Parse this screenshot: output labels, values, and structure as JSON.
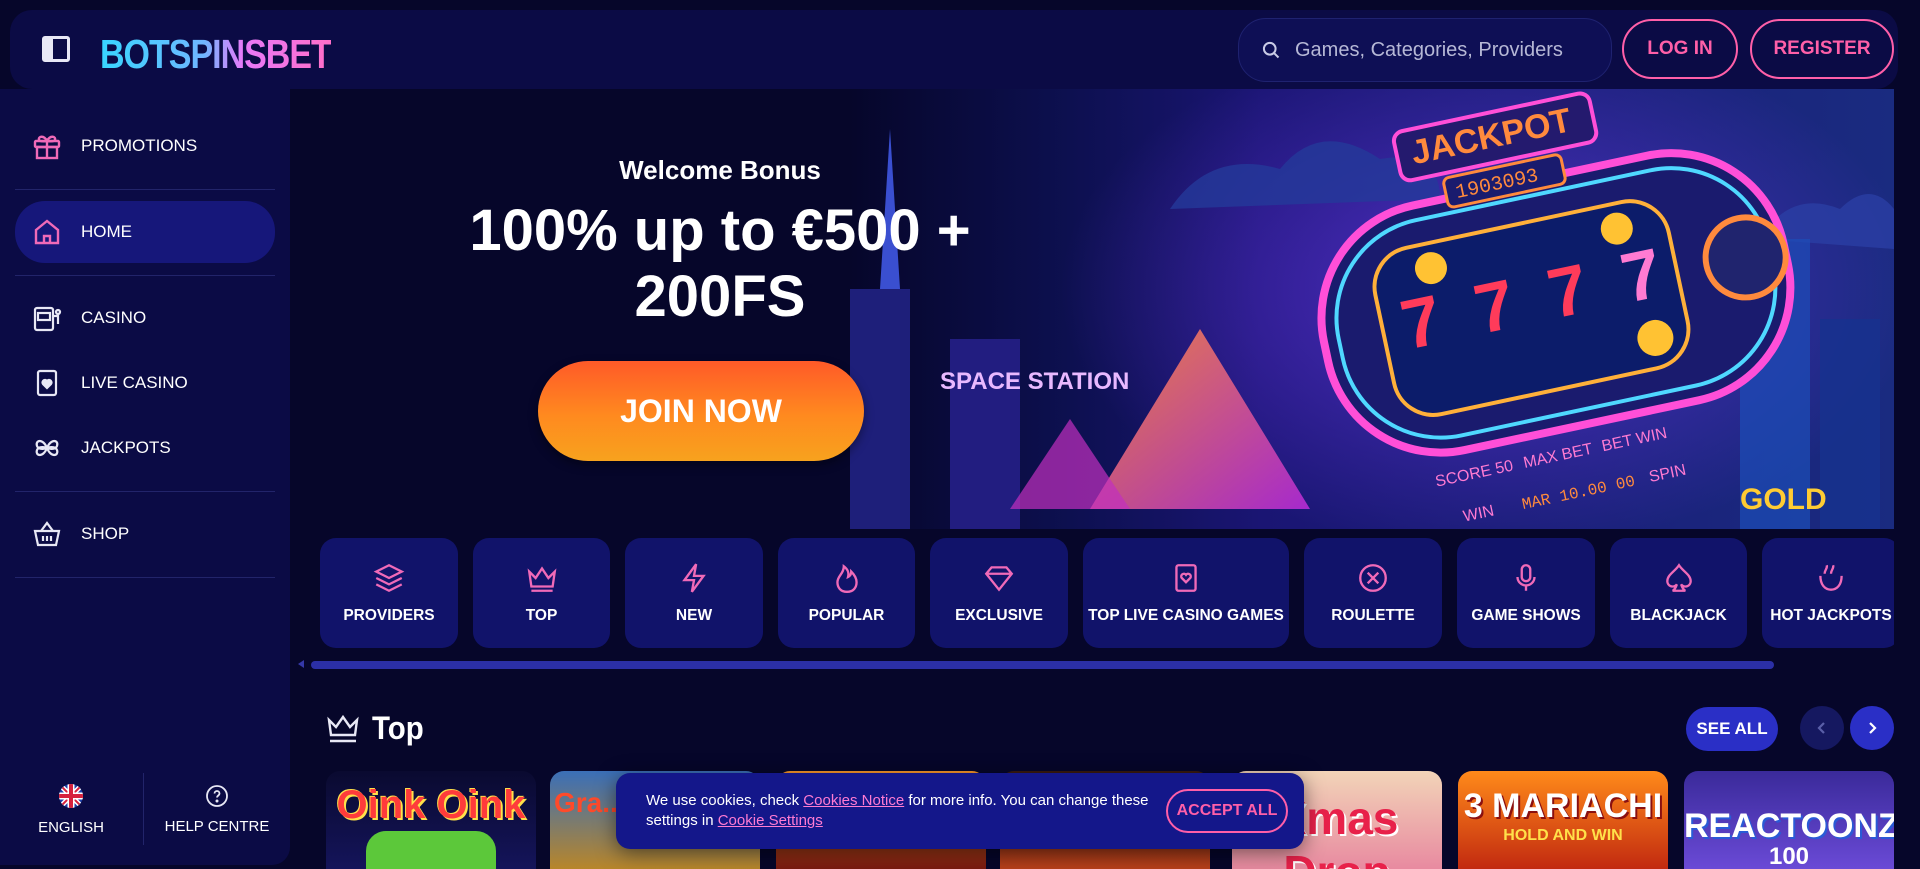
{
  "header": {
    "logo": "BOTSPINSBET",
    "search_placeholder": "Games, Categories, Providers",
    "login_label": "LOG IN",
    "register_label": "REGISTER"
  },
  "sidebar": {
    "items": [
      {
        "label": "PROMOTIONS",
        "icon": "gift-icon"
      },
      {
        "label": "HOME",
        "icon": "home-icon",
        "active": true
      },
      {
        "label": "CASINO",
        "icon": "slot-machine-icon"
      },
      {
        "label": "LIVE CASINO",
        "icon": "card-icon"
      },
      {
        "label": "JACKPOTS",
        "icon": "clover-icon"
      },
      {
        "label": "SHOP",
        "icon": "basket-icon"
      }
    ],
    "language_label": "ENGLISH",
    "help_label": "HELP CENTRE"
  },
  "hero": {
    "subtitle": "Welcome Bonus",
    "title_line1": "100% up to €500 +",
    "title_line2": "200FS",
    "cta_label": "JOIN NOW",
    "art_text": {
      "jackpot": "JACKPOT",
      "jackpot_number": "1903093",
      "station": "SPACE STATION",
      "score": "SCORE 50",
      "max_bet": "MAX BET",
      "bet_win": "BET WIN",
      "win": "WIN",
      "time": "MAR 10.00 00",
      "spin": "SPIN",
      "gold": "GOLD"
    }
  },
  "categories": [
    {
      "label": "PROVIDERS",
      "icon": "layers-icon"
    },
    {
      "label": "TOP",
      "icon": "crown-icon"
    },
    {
      "label": "NEW",
      "icon": "lightning-icon"
    },
    {
      "label": "POPULAR",
      "icon": "flame-icon"
    },
    {
      "label": "EXCLUSIVE",
      "icon": "diamond-icon"
    },
    {
      "label": "TOP LIVE CASINO GAMES",
      "icon": "card-heart-icon"
    },
    {
      "label": "ROULETTE",
      "icon": "roulette-icon"
    },
    {
      "label": "GAME SHOWS",
      "icon": "microphone-icon"
    },
    {
      "label": "BLACKJACK",
      "icon": "spade-icon"
    },
    {
      "label": "HOT JACKPOTS",
      "icon": "hot-pot-icon"
    }
  ],
  "top_section": {
    "title": "Top",
    "see_all_label": "SEE ALL",
    "games": [
      {
        "title": "Oink Oink"
      },
      {
        "title": "Gra... Ho..."
      },
      {
        "title": ""
      },
      {
        "title": ""
      },
      {
        "title": "Xmas Drop"
      },
      {
        "title": "3 MARIACHI",
        "subtitle": "HOLD AND WIN"
      },
      {
        "title": "REACTOONZ",
        "subtitle": "100"
      }
    ]
  },
  "cookie": {
    "text_1": "We use cookies, check ",
    "link_1": "Cookies Notice",
    "text_2": " for more info. You can change these settings in ",
    "link_2": "Cookie Settings",
    "accept_label": "ACCEPT ALL"
  }
}
